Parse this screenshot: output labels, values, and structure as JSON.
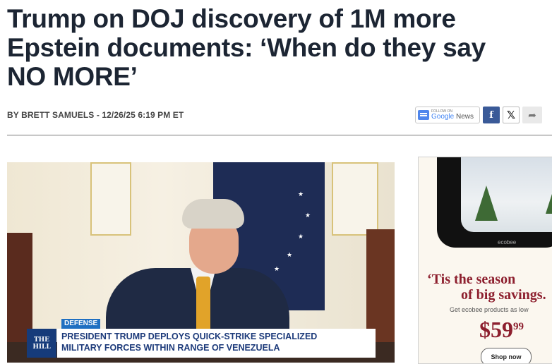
{
  "headline": {
    "line1": "Trump on DOJ discovery of 1M more",
    "line2": "Epstein documents: ‘When do they say",
    "line3": "NO MORE’"
  },
  "byline": {
    "prefix": "BY ",
    "author": "BRETT SAMUELS",
    "separator": " - ",
    "date": "12/26/25 6:19 PM ET"
  },
  "share": {
    "google_news_small": "FOLLOW ON",
    "google_news_label_google": "Google",
    "google_news_label_news": " News",
    "facebook_glyph": "f",
    "x_glyph": "𝕏",
    "more_glyph": "➦"
  },
  "video": {
    "category": "DEFENSE",
    "logo_line1": "THE",
    "logo_line2": "HILL",
    "chyron_line1": "PRESIDENT TRUMP DEPLOYS QUICK-STRIKE SPECIALIZED",
    "chyron_line2": "MILITARY FORCES WITHIN RANGE OF VENEZUELA"
  },
  "ad": {
    "title_line1": "‘Tis the season",
    "title_line2": "of big savings.",
    "subtitle": "Get ecobee products as low",
    "price_main": "$59",
    "price_cents": "99",
    "cta": "Shop now",
    "brand": "ecobee"
  },
  "colors": {
    "headline": "#1c2533",
    "facebook": "#3a5a98",
    "category_tag": "#1f6fc1",
    "ad_accent": "#8d1f2e"
  }
}
